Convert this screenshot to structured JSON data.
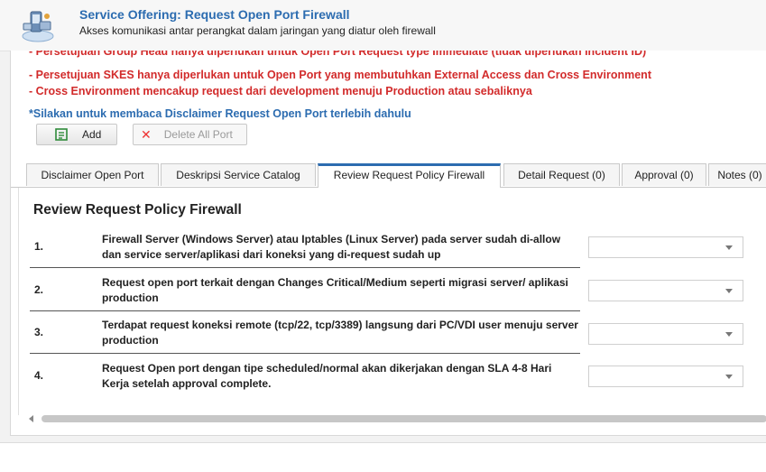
{
  "header": {
    "title": "Service Offering: Request Open Port Firewall",
    "subtitle": "Akses komunikasi antar perangkat dalam jaringan yang diatur oleh firewall",
    "logo_icon": "network-devices-icon"
  },
  "notices": [
    "- Persetujuan Group Head hanya diperlukan untuk Open Port Request type Immediate (tidak diperlukan incident ID)",
    "- Persetujuan SKES hanya diperlukan untuk Open Port yang membutuhkan External Access dan Cross Environment",
    "- Cross Environment mencakup request dari development menuju Production atau sebaliknya"
  ],
  "disclaimer_link": "*Silakan untuk membaca Disclaimer Request Open Port terlebih dahulu",
  "toolbar": {
    "add_label": "Add",
    "delete_all_label": "Delete All Port"
  },
  "tabs": [
    {
      "label": "Disclaimer Open Port",
      "active": false
    },
    {
      "label": "Deskripsi Service Catalog",
      "active": false
    },
    {
      "label": "Review Request Policy Firewall",
      "active": true
    },
    {
      "label": "Detail Request (0)",
      "active": false
    },
    {
      "label": "Approval (0)",
      "active": false
    },
    {
      "label": "Notes (0)",
      "active": false
    }
  ],
  "review": {
    "title": "Review Request Policy Firewall",
    "items": [
      {
        "num": "1.",
        "text": "Firewall Server (Windows Server) atau Iptables (Linux Server) pada server sudah di-allow dan service server/aplikasi dari koneksi yang di-request sudah up",
        "selected": ""
      },
      {
        "num": "2.",
        "text": "Request open port terkait dengan Changes Critical/Medium seperti migrasi server/ aplikasi production",
        "selected": ""
      },
      {
        "num": "3.",
        "text": "Terdapat request koneksi remote (tcp/22, tcp/3389) langsung dari PC/VDI user menuju server production",
        "selected": ""
      },
      {
        "num": "4.",
        "text": "Request Open port dengan tipe scheduled/normal akan dikerjakan dengan SLA 4-8 Hari Kerja setelah approval complete.",
        "selected": ""
      }
    ]
  },
  "colors": {
    "title_blue": "#2c6cb0",
    "notice_red": "#d22b2b",
    "delete_red": "#e33333",
    "add_green": "#2e8b3a"
  }
}
